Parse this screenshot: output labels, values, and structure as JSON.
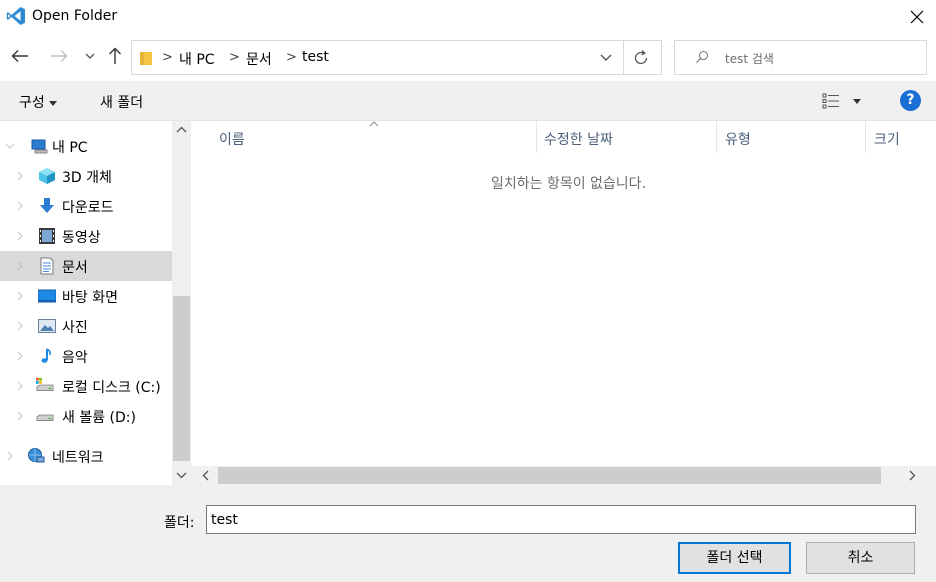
{
  "window": {
    "title": "Open Folder"
  },
  "address": {
    "crumbs": [
      "내 PC",
      "문서",
      "test"
    ]
  },
  "search": {
    "placeholder": "test 검색"
  },
  "toolbar": {
    "organize_label": "구성",
    "new_folder_label": "새 폴더",
    "help_label": "?"
  },
  "nav": {
    "items": [
      {
        "label": "내 PC",
        "icon": "pc-icon"
      },
      {
        "label": "3D 개체",
        "icon": "3d-objects-icon"
      },
      {
        "label": "다운로드",
        "icon": "download-icon"
      },
      {
        "label": "동영상",
        "icon": "video-icon"
      },
      {
        "label": "문서",
        "icon": "document-icon",
        "selected": true
      },
      {
        "label": "바탕 화면",
        "icon": "desktop-icon"
      },
      {
        "label": "사진",
        "icon": "picture-icon"
      },
      {
        "label": "음악",
        "icon": "music-icon"
      },
      {
        "label": "로컬 디스크 (C:)",
        "icon": "local-disk-icon"
      },
      {
        "label": "새 볼륨 (D:)",
        "icon": "drive-icon"
      },
      {
        "label": "네트워크",
        "icon": "network-icon"
      }
    ]
  },
  "content": {
    "columns": [
      "이름",
      "수정한 날짜",
      "유형",
      "크기"
    ],
    "empty_message": "일치하는 항목이 없습니다."
  },
  "footer": {
    "folder_label": "폴더:",
    "folder_value": "test",
    "select_button": "폴더 선택",
    "cancel_button": "취소"
  },
  "colors": {
    "accent": "#0078d7",
    "help": "#1a6fd6",
    "selected_bg": "#d9d9d9",
    "vscode_blue": "#2a8ad4"
  }
}
